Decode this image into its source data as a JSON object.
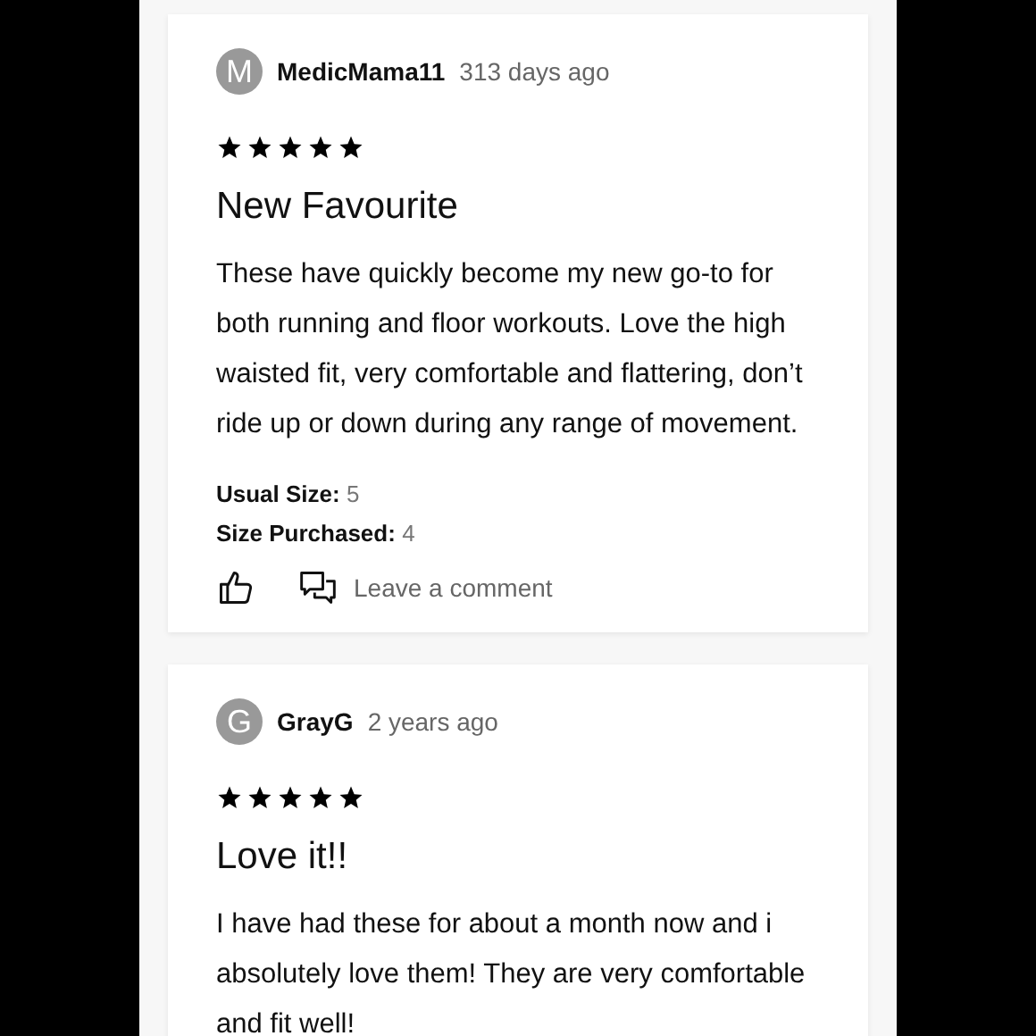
{
  "reviews": [
    {
      "initial": "M",
      "author": "MedicMama11",
      "time": "313 days ago",
      "stars": 5,
      "title": "New Favourite",
      "body": "These have quickly become my new go-to for both running and floor workouts. Love the high waisted fit, very comfortable and flattering, don’t ride up or down during any range of movement.",
      "details": [
        {
          "label": "Usual Size:",
          "value": "5"
        },
        {
          "label": "Size Purchased:",
          "value": "4"
        }
      ],
      "comment_label": "Leave a comment"
    },
    {
      "initial": "G",
      "author": "GrayG",
      "time": "2 years ago",
      "stars": 5,
      "title": "Love it!!",
      "body": "I have had these for about a month now and i absolutely love them! They are very comfortable and fit well!"
    }
  ]
}
